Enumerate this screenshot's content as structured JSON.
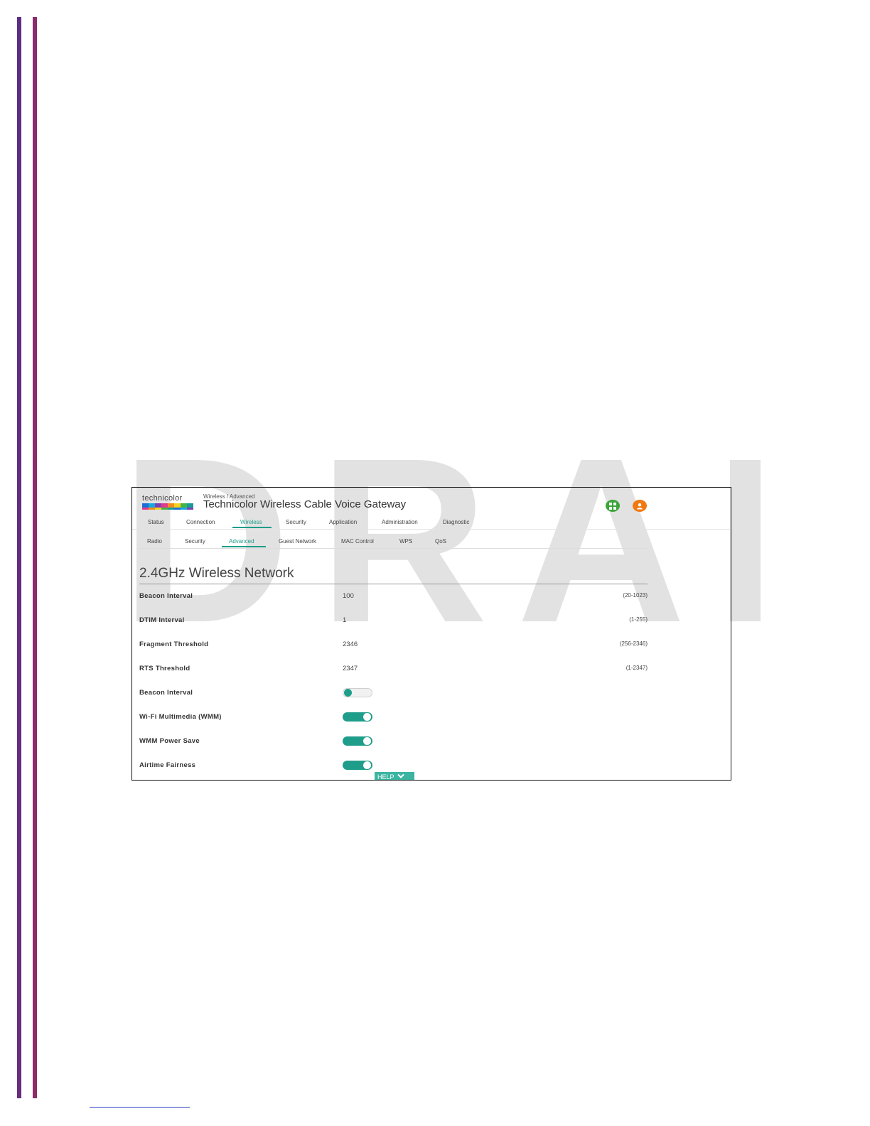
{
  "watermark": "DRAFT",
  "header": {
    "logo_text": "technicolor",
    "logo_colors": [
      "#1d6fd8",
      "#16a8df",
      "#7e3fb5",
      "#e23a8d",
      "#f28c1c",
      "#f6d21f",
      "#43b548",
      "#1b9a9a"
    ],
    "breadcrumb": "Wireless / Advanced",
    "title": "Technicolor Wireless Cable Voice Gateway",
    "icons": [
      "grid-icon",
      "user-icon"
    ]
  },
  "main_nav": [
    "Status",
    "Connection",
    "Wireless",
    "Security",
    "Application",
    "Administration",
    "Diagnostic"
  ],
  "main_nav_active": "Wireless",
  "sub_nav": [
    "Radio",
    "Security",
    "Advanced",
    "Guest Network",
    "MAC Control",
    "WPS",
    "QoS"
  ],
  "sub_nav_active": "Advanced",
  "section_title": "2.4GHz Wireless Network",
  "fields": [
    {
      "label": "Beacon Interval",
      "value": "100",
      "range": "(20-1023)"
    },
    {
      "label": "DTIM Interval",
      "value": "1",
      "range": "(1-255)"
    },
    {
      "label": "Fragment Threshold",
      "value": "2346",
      "range": "(256-2346)"
    },
    {
      "label": "RTS Threshold",
      "value": "2347",
      "range": "(1-2347)"
    }
  ],
  "toggles": [
    {
      "label": "Beacon Interval",
      "on": false
    },
    {
      "label": "Wi-Fi Multimedia (WMM)",
      "on": true
    },
    {
      "label": "WMM Power Save",
      "on": true
    },
    {
      "label": "Airtime Fairness",
      "on": true
    }
  ],
  "help_label": "HELP",
  "colors": {
    "accent": "#1f9d8b",
    "grid_icon": "#3ca53a",
    "user_icon": "#ef7a14",
    "bar_left": "#5b2d86",
    "bar_right": "#8a2b6f"
  }
}
